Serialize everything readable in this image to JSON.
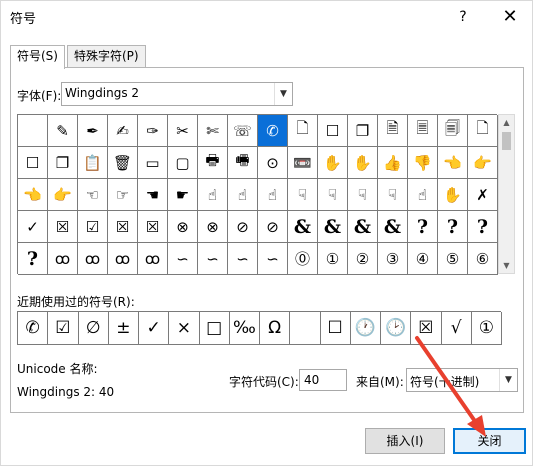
{
  "window": {
    "title": "符号",
    "help_label": "?",
    "close_label": "✕"
  },
  "tabs": [
    {
      "label": "符号(S)",
      "active": true
    },
    {
      "label": "特殊字符(P)",
      "active": false
    }
  ],
  "font": {
    "label": "字体(F):",
    "value": "Wingdings 2"
  },
  "symbol_grid": {
    "rows": [
      [
        "",
        "✎",
        "✒",
        "✍",
        "✑",
        "✂",
        "✄",
        "☏",
        "✆",
        "🗋",
        "☐",
        "❐",
        "🗎",
        "🗏",
        "🗐",
        "🗋"
      ],
      [
        "☐",
        "❐",
        "📋",
        "🗑",
        "▭",
        "▢",
        "🖶",
        "🖷",
        "⊙",
        "📼",
        "✋",
        "✋",
        "👍",
        "👎",
        "👈",
        "👉"
      ],
      [
        "👈",
        "👉",
        "☜",
        "☞",
        "☚",
        "☛",
        "☝",
        "☝",
        "☝",
        "☟",
        "☟",
        "☟",
        "☟",
        "☝",
        "✋",
        "✗"
      ],
      [
        "✓",
        "☒",
        "☑",
        "☒",
        "☒",
        "⊗",
        "⊗",
        "⊘",
        "⊘",
        "&",
        "&",
        "&",
        "&",
        "?",
        "?",
        "?"
      ],
      [
        "?",
        "ꝏ",
        "ꝏ",
        "ꝏ",
        "ꝏ",
        "∽",
        "∽",
        "∽",
        "∽",
        "⓪",
        "①",
        "②",
        "③",
        "④",
        "⑤",
        "⑥"
      ]
    ],
    "selected": {
      "row": 0,
      "col": 8
    }
  },
  "recent": {
    "label": "近期使用过的符号(R):",
    "symbols": [
      "✆",
      "☑",
      "∅",
      "±",
      "✓",
      "×",
      "□",
      "‰",
      "Ω",
      "",
      "☐",
      "🕐",
      "🕑",
      "☒",
      "√",
      "①"
    ]
  },
  "info": {
    "unicode_name_label": "Unicode 名称:",
    "unicode_name_value": "Wingdings 2: 40",
    "char_code_label": "字符代码(C):",
    "char_code_value": "40",
    "from_label": "来自(M):",
    "from_value": "符号(十进制)"
  },
  "buttons": {
    "insert": "插入(I)",
    "close": "关闭"
  },
  "colors": {
    "selection": "#0a6fd8",
    "accent": "#0078d7",
    "annotation_arrow": "#e8402e"
  }
}
